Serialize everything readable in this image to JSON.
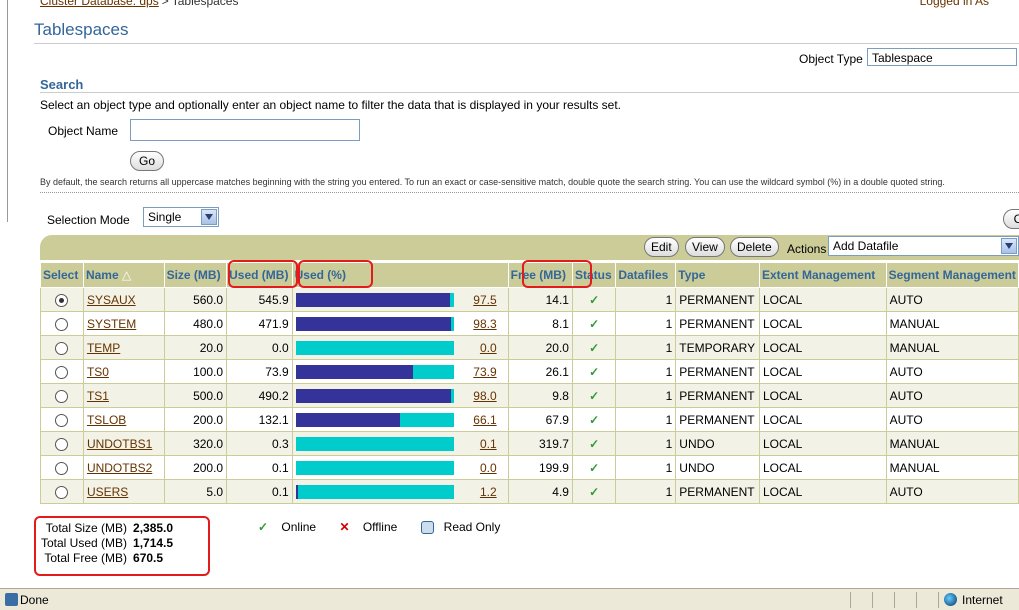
{
  "breadcrumb": {
    "parent": "Cluster Database: dps",
    "separator": ">",
    "current": "Tablespaces"
  },
  "logged_in": "Logged in As",
  "page_title": "Tablespaces",
  "object_type": {
    "label": "Object Type",
    "value": "Tablespace"
  },
  "search": {
    "heading": "Search",
    "description": "Select an object type and optionally enter an object name to filter the data that is displayed in your results set.",
    "object_name_label": "Object Name",
    "object_name_value": "",
    "go_label": "Go",
    "hint": "By default, the search returns all uppercase matches beginning with the string you entered. To run an exact or case-sensitive match, double quote the search string. You can use the wildcard symbol (%) in a double quoted string."
  },
  "selection_mode": {
    "label": "Selection Mode",
    "value": "Single"
  },
  "right_button_label": "C",
  "toolbar": {
    "edit": "Edit",
    "view": "View",
    "delete": "Delete",
    "actions_label": "Actions",
    "actions_value": "Add Datafile"
  },
  "columns": [
    "Select",
    "Name",
    "Size (MB)",
    "Used (MB)",
    "Used (%)",
    "Free (MB)",
    "Status",
    "Datafiles",
    "Type",
    "Extent Management",
    "Segment Management"
  ],
  "sort_indicator": "△",
  "rows": [
    {
      "name": "SYSAUX",
      "size": "560.0",
      "used": "545.9",
      "pct": "97.5",
      "pct_value": 97.5,
      "free": "14.1",
      "status": "✓",
      "datafiles": "1",
      "type": "PERMANENT",
      "extent": "LOCAL",
      "segment": "AUTO",
      "selected": true
    },
    {
      "name": "SYSTEM",
      "size": "480.0",
      "used": "471.9",
      "pct": "98.3",
      "pct_value": 98.3,
      "free": "8.1",
      "status": "✓",
      "datafiles": "1",
      "type": "PERMANENT",
      "extent": "LOCAL",
      "segment": "MANUAL",
      "selected": false
    },
    {
      "name": "TEMP",
      "size": "20.0",
      "used": "0.0",
      "pct": "0.0",
      "pct_value": 0.0,
      "free": "20.0",
      "status": "✓",
      "datafiles": "1",
      "type": "TEMPORARY",
      "extent": "LOCAL",
      "segment": "MANUAL",
      "selected": false
    },
    {
      "name": "TS0",
      "size": "100.0",
      "used": "73.9",
      "pct": "73.9",
      "pct_value": 73.9,
      "free": "26.1",
      "status": "✓",
      "datafiles": "1",
      "type": "PERMANENT",
      "extent": "LOCAL",
      "segment": "AUTO",
      "selected": false
    },
    {
      "name": "TS1",
      "size": "500.0",
      "used": "490.2",
      "pct": "98.0",
      "pct_value": 98.0,
      "free": "9.8",
      "status": "✓",
      "datafiles": "1",
      "type": "PERMANENT",
      "extent": "LOCAL",
      "segment": "AUTO",
      "selected": false
    },
    {
      "name": "TSLOB",
      "size": "200.0",
      "used": "132.1",
      "pct": "66.1",
      "pct_value": 66.1,
      "free": "67.9",
      "status": "✓",
      "datafiles": "1",
      "type": "PERMANENT",
      "extent": "LOCAL",
      "segment": "AUTO",
      "selected": false
    },
    {
      "name": "UNDOTBS1",
      "size": "320.0",
      "used": "0.3",
      "pct": "0.1",
      "pct_value": 0.1,
      "free": "319.7",
      "status": "✓",
      "datafiles": "1",
      "type": "UNDO",
      "extent": "LOCAL",
      "segment": "MANUAL",
      "selected": false
    },
    {
      "name": "UNDOTBS2",
      "size": "200.0",
      "used": "0.1",
      "pct": "0.0",
      "pct_value": 0.0,
      "free": "199.9",
      "status": "✓",
      "datafiles": "1",
      "type": "UNDO",
      "extent": "LOCAL",
      "segment": "MANUAL",
      "selected": false
    },
    {
      "name": "USERS",
      "size": "5.0",
      "used": "0.1",
      "pct": "1.2",
      "pct_value": 1.2,
      "free": "4.9",
      "status": "✓",
      "datafiles": "1",
      "type": "PERMANENT",
      "extent": "LOCAL",
      "segment": "AUTO",
      "selected": false
    }
  ],
  "totals": {
    "size_label": "Total Size (MB)",
    "size": "2,385.0",
    "used_label": "Total Used (MB)",
    "used": "1,714.5",
    "free_label": "Total Free (MB)",
    "free": "670.5"
  },
  "legend": {
    "online": "Online",
    "offline": "Offline",
    "read_only": "Read Only",
    "online_symbol": "✓",
    "offline_symbol": "✕"
  },
  "status_bar": {
    "text": "Done",
    "zone": "Internet"
  },
  "colors": {
    "header_bg": "#cccc99",
    "used_bar": "#333399",
    "free_bar": "#00cccc",
    "highlight": "#e31b1b",
    "title": "#336699",
    "link": "#663300"
  }
}
